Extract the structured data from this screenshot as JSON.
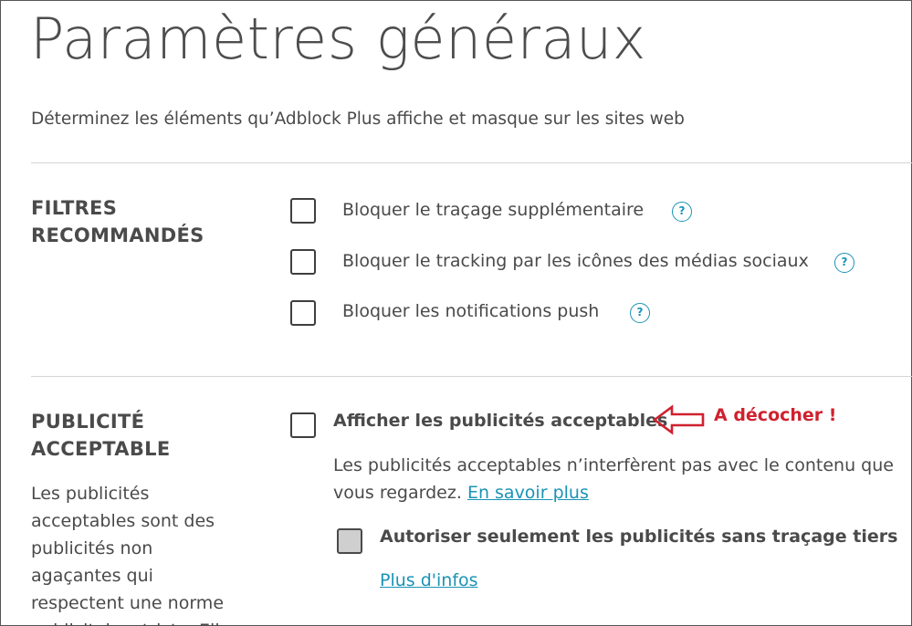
{
  "page": {
    "title": "Paramètres généraux",
    "description": "Déterminez les éléments qu’Adblock Plus affiche et masque sur les sites web"
  },
  "recommended_filters": {
    "heading_line1": "FILTRES",
    "heading_line2": "RECOMMANDÉS",
    "options": [
      {
        "label": "Bloquer le traçage supplémentaire",
        "checked": false,
        "help_icon": "?"
      },
      {
        "label": "Bloquer le tracking par les icônes des médias sociaux",
        "checked": false,
        "help_icon": "?"
      },
      {
        "label": "Bloquer les notifications push",
        "checked": false,
        "help_icon": "?"
      }
    ]
  },
  "acceptable_ads": {
    "heading_line1": "PUBLICITÉ",
    "heading_line2": "ACCEPTABLE",
    "side_text_lines": [
      "Les publicités",
      "acceptables sont des",
      "publicités non",
      "agaçantes qui",
      "respectent une norme",
      "publicitaire stricte. Ell"
    ],
    "main_option": {
      "label": "Afficher les publicités acceptables",
      "checked": false
    },
    "explanation_line1": "Les publicités acceptables n’interfèrent pas avec le contenu que",
    "explanation_line2": "vous regardez.",
    "learn_more_link": "En savoir plus",
    "sub_option": {
      "label": "Autoriser seulement les publicités sans traçage tiers",
      "checked": false,
      "disabled": true
    },
    "more_info_link": "Plus d'infos"
  },
  "annotation": {
    "text": "A décocher !",
    "color": "#d0202e"
  },
  "colors": {
    "link": "#1a93b5",
    "text": "#4a4a4a",
    "divider": "#d6d6d6"
  }
}
